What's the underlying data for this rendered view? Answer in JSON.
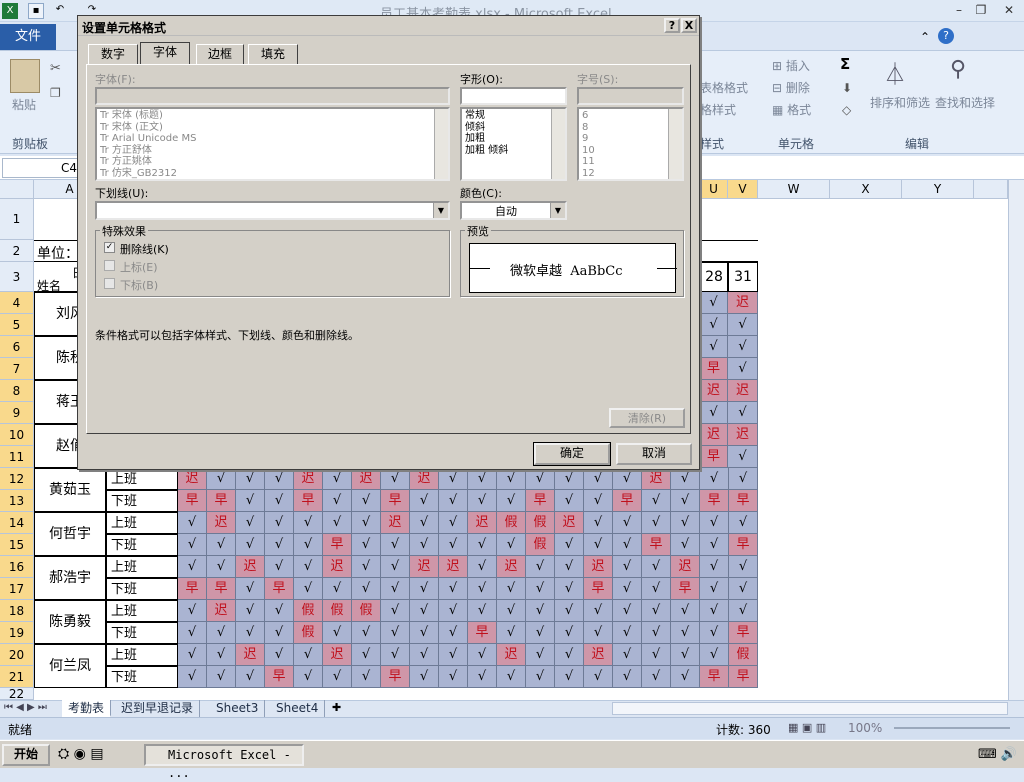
{
  "window": {
    "title": "员工基本考勤表.xlsx - Microsoft Excel"
  },
  "ribbon": {
    "file_tab": "文件",
    "paste_label": "粘贴",
    "clipboard_label": "剪贴板",
    "style_items": [
      "表格格式",
      "格样式",
      "样式"
    ],
    "insert": "插入",
    "delete": "删除",
    "format": "格式",
    "cells_label": "单元格",
    "sort_filter": "排序和筛选",
    "find_select": "查找和选择",
    "edit_label": "编辑",
    "sigma": "Σ"
  },
  "namebox": "C4",
  "columns_visible": [
    "A",
    "U",
    "V",
    "W",
    "X",
    "Y"
  ],
  "header_cells": {
    "unit": "单位：",
    "name": "姓名",
    "day": "日",
    "d28": "28",
    "d31": "31"
  },
  "rows": [
    "1",
    "2",
    "3",
    "4",
    "5",
    "6",
    "7",
    "8",
    "9",
    "10",
    "11",
    "12",
    "13",
    "14",
    "15",
    "16",
    "17",
    "18",
    "19",
    "20",
    "21",
    "22"
  ],
  "employees": [
    {
      "name": "刘风",
      "row": 4
    },
    {
      "name": "陈秋",
      "row": 6
    },
    {
      "name": "蒋玉",
      "row": 8
    },
    {
      "name": "赵俏",
      "row": 10
    },
    {
      "name": "黄茹玉",
      "row": 12
    },
    {
      "name": "何哲宇",
      "row": 14
    },
    {
      "name": "郝浩宇",
      "row": 16
    },
    {
      "name": "陈勇毅",
      "row": 18
    },
    {
      "name": "何兰凤",
      "row": 20
    }
  ],
  "shifts": {
    "on": "上班",
    "off": "下班"
  },
  "uv_right": [
    [
      "√",
      "迟"
    ],
    [
      "√",
      "√"
    ],
    [
      "√",
      "√"
    ],
    [
      "早",
      "√"
    ],
    [
      "迟",
      "迟"
    ],
    [
      "√",
      "√"
    ],
    [
      "迟",
      "迟"
    ],
    [
      "早",
      "√"
    ]
  ],
  "grid_rows": [
    [
      "迟",
      "√",
      "√",
      "√",
      "迟",
      "√",
      "迟",
      "√",
      "迟",
      "√",
      "√",
      "√",
      "√",
      "√",
      "√",
      "√",
      "迟",
      "√",
      "√",
      "√"
    ],
    [
      "早",
      "早",
      "√",
      "√",
      "早",
      "√",
      "√",
      "早",
      "√",
      "√",
      "√",
      "√",
      "早",
      "√",
      "√",
      "早",
      "√",
      "√",
      "早",
      "早"
    ],
    [
      "√",
      "迟",
      "√",
      "√",
      "√",
      "√",
      "√",
      "迟",
      "√",
      "√",
      "迟",
      "假",
      "假",
      "迟",
      "√",
      "√",
      "√",
      "√",
      "√",
      "√"
    ],
    [
      "√",
      "√",
      "√",
      "√",
      "√",
      "早",
      "√",
      "√",
      "√",
      "√",
      "√",
      "√",
      "假",
      "√",
      "√",
      "√",
      "早",
      "√",
      "√",
      "早"
    ],
    [
      "√",
      "√",
      "迟",
      "√",
      "√",
      "迟",
      "√",
      "√",
      "迟",
      "迟",
      "√",
      "迟",
      "√",
      "√",
      "迟",
      "√",
      "√",
      "迟",
      "√",
      "√"
    ],
    [
      "早",
      "早",
      "√",
      "早",
      "√",
      "√",
      "√",
      "√",
      "√",
      "√",
      "√",
      "√",
      "√",
      "√",
      "早",
      "√",
      "√",
      "早",
      "√",
      "√"
    ],
    [
      "√",
      "迟",
      "√",
      "√",
      "假",
      "假",
      "假",
      "√",
      "√",
      "√",
      "√",
      "√",
      "√",
      "√",
      "√",
      "√",
      "√",
      "√",
      "√",
      "√"
    ],
    [
      "√",
      "√",
      "√",
      "√",
      "假",
      "√",
      "√",
      "√",
      "√",
      "√",
      "早",
      "√",
      "√",
      "√",
      "√",
      "√",
      "√",
      "√",
      "√",
      "早"
    ],
    [
      "√",
      "√",
      "迟",
      "√",
      "√",
      "迟",
      "√",
      "√",
      "√",
      "√",
      "√",
      "迟",
      "√",
      "√",
      "迟",
      "√",
      "√",
      "√",
      "√",
      "假"
    ],
    [
      "√",
      "√",
      "√",
      "早",
      "√",
      "√",
      "√",
      "早",
      "√",
      "√",
      "√",
      "√",
      "√",
      "√",
      "√",
      "√",
      "√",
      "√",
      "早",
      "早"
    ]
  ],
  "sheet_tabs": [
    "考勤表",
    "迟到早退记录",
    "Sheet3",
    "Sheet4"
  ],
  "status": {
    "ready": "就绪",
    "count": "计数: 360",
    "zoom": "100%"
  },
  "taskbar": {
    "start": "开始",
    "excel_task": "Microsoft Excel - ..."
  },
  "dialog": {
    "title": "设置单元格格式",
    "help": "?",
    "close": "X",
    "tabs": [
      "数字",
      "字体",
      "边框",
      "填充"
    ],
    "active_tab": 1,
    "font_label": "字体(F):",
    "style_label": "字形(O):",
    "size_label": "字号(S):",
    "fonts": [
      "宋体 (标题)",
      "宋体 (正文)",
      "Arial Unicode MS",
      "方正舒体",
      "方正姚体",
      "仿宋_GB2312"
    ],
    "styles": [
      "常规",
      "倾斜",
      "加粗",
      "加粗 倾斜"
    ],
    "sizes": [
      "6",
      "8",
      "9",
      "10",
      "11",
      "12"
    ],
    "underline_label": "下划线(U):",
    "color_label": "颜色(C):",
    "color_value": "自动",
    "effects_label": "特殊效果",
    "strike_label": "删除线(K)",
    "super_label": "上标(E)",
    "sub_label": "下标(B)",
    "preview_label": "预览",
    "preview_text": "微软卓越  AaBbCc",
    "note": "条件格式可以包括字体样式、下划线、颜色和删除线。",
    "clear_btn": "清除(R)",
    "ok_btn": "确定",
    "cancel_btn": "取消"
  }
}
